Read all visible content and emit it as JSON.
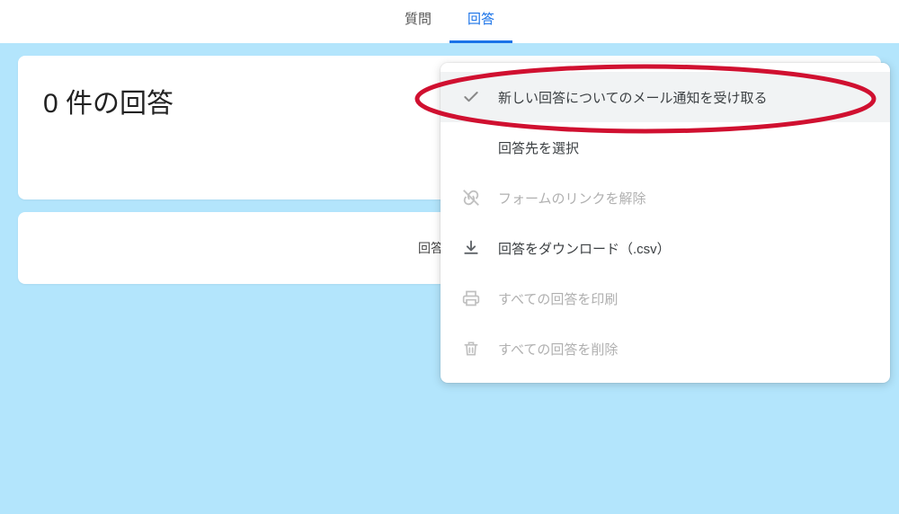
{
  "tabs": {
    "questions": "質問",
    "responses": "回答"
  },
  "card1": {
    "title": "0 件の回答"
  },
  "card2": {
    "accepting_label_partial": "回答を受け"
  },
  "menu": {
    "items": [
      {
        "label": "新しい回答についてのメール通知を受け取る"
      },
      {
        "label": "回答先を選択"
      },
      {
        "label": "フォームのリンクを解除"
      },
      {
        "label": "回答をダウンロード（.csv）"
      },
      {
        "label": "すべての回答を印刷"
      },
      {
        "label": "すべての回答を削除"
      }
    ]
  }
}
